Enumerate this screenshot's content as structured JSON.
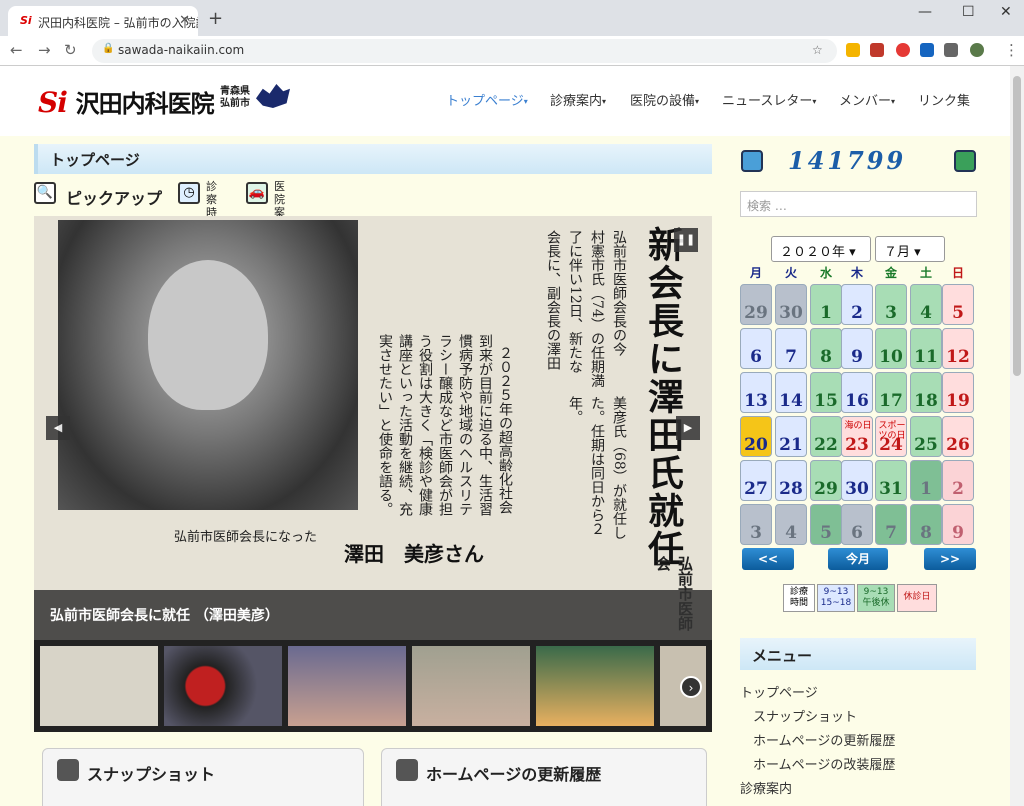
{
  "browser": {
    "tab_title": "沢田内科医院 – 弘前市の入院診療",
    "url": "sawada-naikaiin.com"
  },
  "header": {
    "logo_text": "沢田内科医院",
    "logo_sub1": "青森県",
    "logo_sub2": "弘前市",
    "nav": [
      "トップページ",
      "診療案内",
      "医院の設備",
      "ニュースレター",
      "メンバー",
      "リンク集"
    ]
  },
  "main": {
    "section_title": "トップページ",
    "pickup_label": "ピックアップ",
    "shortcut1": [
      "診察",
      "時間"
    ],
    "shortcut2": [
      "医院",
      "案内"
    ],
    "slide_headline": "新会長に澤田氏就任",
    "slide_sub": "弘前市医師会",
    "slide_caption": "弘前市医師会長に就任 （澤田美彦）",
    "article_name": "澤田　美彦さん",
    "article_lead": "弘前市医師会長になった",
    "article_col1": "２０２５年の超高齢化社会",
    "article_col2": "到来が目前に迫る中、生活習",
    "article_col3": "慣病予防や地域のヘルスリテ",
    "article_col4": "ラシー醸成など市医師会が担",
    "article_col5": "う役割は大きく「検診や健康",
    "article_col6": "講座といった活動を継続、充",
    "article_col7": "実させたい」と使命を語る。",
    "news_col1": "弘前市医師会長の今",
    "news_col2": "村憲市氏（74）の任期満",
    "news_col3": "了に伴い12日、新たな",
    "news_col4": "会長に、副会長の澤田",
    "news_col5": "美彦氏（68）が就任し",
    "news_col6": "た。任期は同日から２",
    "news_col7": "年。",
    "bottom_box1": "スナップショット",
    "bottom_box2": "ホームページの更新履歴"
  },
  "sidebar": {
    "counter": "141799",
    "search_placeholder": "検索 …",
    "year_select": "２０２０年",
    "month_select": "７月",
    "weekdays": [
      "月",
      "火",
      "水",
      "木",
      "金",
      "土",
      "日"
    ],
    "weekday_colors": [
      "#1a2a8a",
      "#1a2a8a",
      "#1a7a2a",
      "#1a2a8a",
      "#1a7a2a",
      "#1a7a2a",
      "#c01818"
    ],
    "calendar_rows": [
      [
        "29",
        "30",
        "1",
        "2",
        "3",
        "4",
        "5"
      ],
      [
        "6",
        "7",
        "8",
        "9",
        "10",
        "11",
        "12"
      ],
      [
        "13",
        "14",
        "15",
        "16",
        "17",
        "18",
        "19"
      ],
      [
        "20",
        "21",
        "22",
        "23",
        "24",
        "25",
        "26"
      ],
      [
        "27",
        "28",
        "29",
        "30",
        "31",
        "1",
        "2"
      ],
      [
        "3",
        "4",
        "5",
        "6",
        "7",
        "8",
        "9"
      ]
    ],
    "holiday1": "海の日",
    "holiday2": "スポーツの日",
    "prev_btn": "<<",
    "today_btn": "今月",
    "next_btn": ">>",
    "legend": {
      "label": [
        "診療",
        "時間"
      ],
      "a": [
        "9~13",
        "15~18"
      ],
      "b": [
        "9~13",
        "午後休"
      ],
      "c": "休診日"
    },
    "menu_title": "メニュー",
    "menu_items": [
      "トップページ",
      "スナップショット",
      "ホームページの更新履歴",
      "ホームページの改装履歴",
      "診療案内"
    ]
  }
}
